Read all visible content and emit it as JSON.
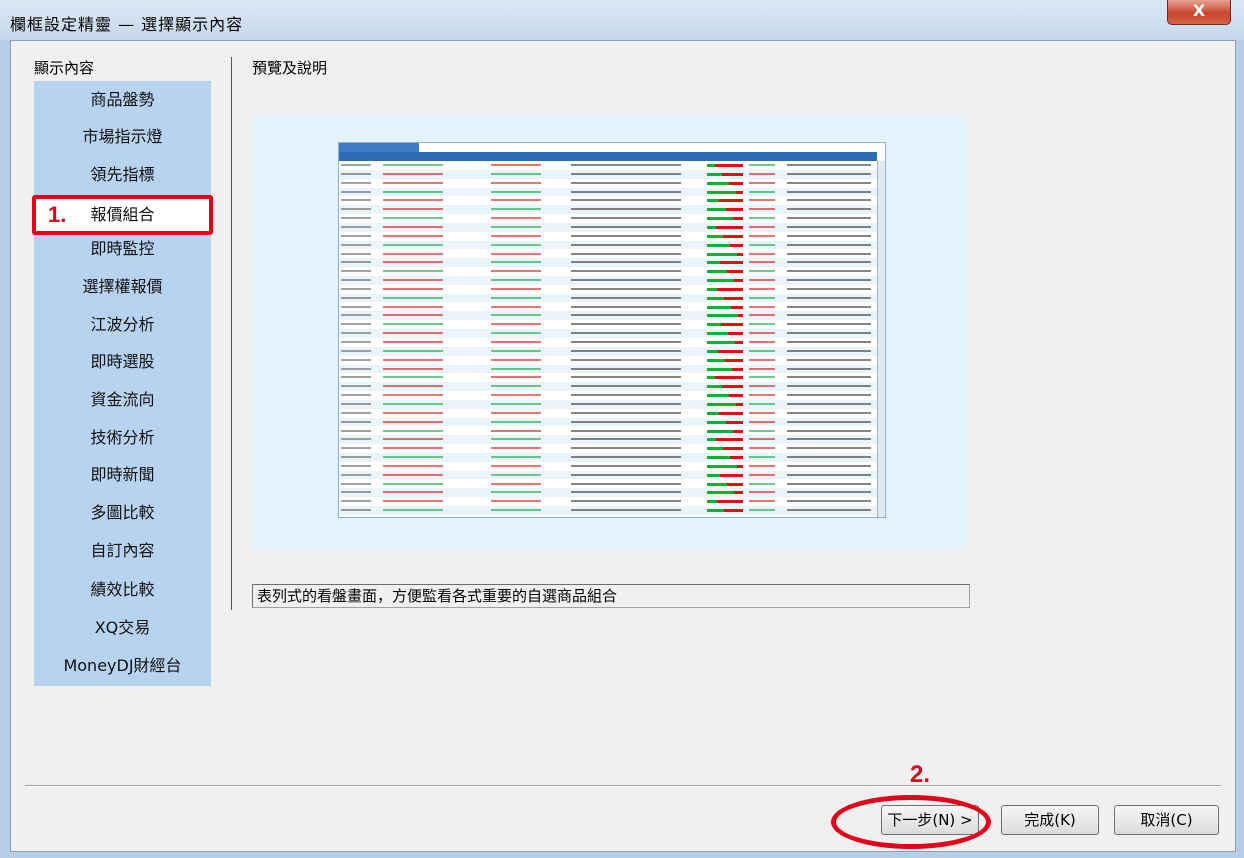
{
  "window": {
    "title": "欄框設定精靈 — 選擇顯示內容",
    "close_label": "X"
  },
  "left_panel": {
    "heading": "顯示內容",
    "items": [
      "商品盤勢",
      "市場指示燈",
      "領先指標",
      "報價組合",
      "即時監控",
      "選擇權報價",
      "江波分析",
      "即時選股",
      "資金流向",
      "技術分析",
      "即時新聞",
      "多圖比較",
      "自訂內容",
      "績效比較",
      "XQ交易",
      "MoneyDJ財經台"
    ],
    "selected_index": 3
  },
  "preview": {
    "heading": "預覽及說明",
    "description": "表列式的看盤畫面，方便監看各式重要的自選商品組合"
  },
  "annotations": {
    "step1": "1.",
    "step2": "2."
  },
  "buttons": {
    "next": "下一步(N) >",
    "finish": "完成(K)",
    "cancel": "取消(C)"
  },
  "colors": {
    "accent_red": "#e3001b",
    "panel_blue": "#b7d3ef",
    "up": "#d60000",
    "down": "#009a2e"
  }
}
